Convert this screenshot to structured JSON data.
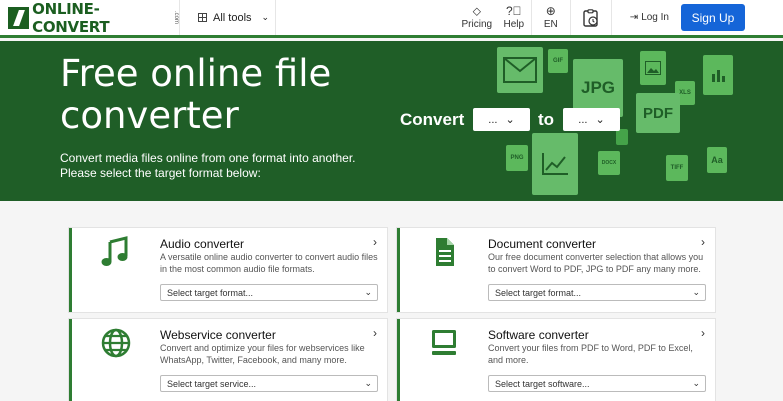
{
  "header": {
    "logo_text": "ONLINE-CONVERT",
    "logo_com": ".com",
    "all_tools": "All tools",
    "pricing": "Pricing",
    "help": "Help",
    "lang": "EN",
    "login": "Log In",
    "signup": "Sign Up"
  },
  "hero": {
    "title": "Free online file converter",
    "subtitle": "Convert media files online from one format into another. Please select the target format below:",
    "convert_label": "Convert",
    "to_label": "to",
    "from_value": "...",
    "to_value": "...",
    "file_labels": {
      "gif": "GIF",
      "jpg": "JPG",
      "pdf": "PDF",
      "xls": "XLS",
      "png": "PNG",
      "docx": "DOCX",
      "tiff": "TIFF",
      "aa": "Aa"
    }
  },
  "cards": [
    {
      "title": "Audio converter",
      "desc": "A versatile online audio converter to convert audio files in the most common audio file formats.",
      "select": "Select target format..."
    },
    {
      "title": "Document converter",
      "desc": "Our free document converter selection that allows you to convert Word to PDF, JPG to PDF any many more.",
      "select": "Select target format..."
    },
    {
      "title": "Webservice converter",
      "desc": "Convert and optimize your files for webservices like WhatsApp, Twitter, Facebook, and many more.",
      "select": "Select target service..."
    },
    {
      "title": "Software converter",
      "desc": "Convert your files from PDF to Word, PDF to Excel, and more.",
      "select": "Select target software..."
    }
  ],
  "colors": {
    "brand_green": "#1f5e27",
    "accent_green": "#2e7d32",
    "signup_blue": "#1565d8"
  }
}
